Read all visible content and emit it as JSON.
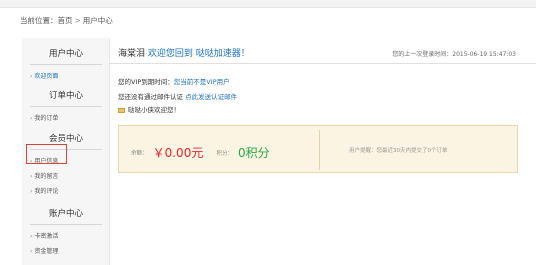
{
  "breadcrumb": {
    "prefix": "当前位置：",
    "home": "首页",
    "sep": ">",
    "current": "用户中心"
  },
  "sidebar": {
    "sections": [
      {
        "title": "用户中心",
        "items": [
          {
            "label": "欢迎页面",
            "active": true
          }
        ]
      },
      {
        "title": "订单中心",
        "items": [
          {
            "label": "我的订单"
          }
        ]
      },
      {
        "title": "会员中心",
        "items": [
          {
            "label": "用户信息"
          },
          {
            "label": "我的留言"
          },
          {
            "label": "我的评论"
          }
        ]
      },
      {
        "title": "账户中心",
        "items": [
          {
            "label": "卡密激活"
          },
          {
            "label": "资金管理"
          }
        ]
      }
    ]
  },
  "main": {
    "username": "海棠泪",
    "welcome": "欢迎您回到 哒哒加速器！",
    "last_login": "您的上一次登录时间：2015-06-19 15:47:03",
    "vip_label": "您的VIP到期时间：",
    "vip_value": "您当前不是VIP用户",
    "email_label": "您还没有通过邮件认证",
    "email_link": "点此发送认证邮件",
    "greeting": "哒哒小侠欢迎您！",
    "balance_label": "余额：",
    "balance_value": "￥0.00元",
    "points_label": "积分：",
    "points_value": "0积分",
    "tip": "用户提醒：您最近30天内提交了0个订单"
  },
  "colors": {
    "link_blue": "#1a6fc0",
    "money_red": "#e3262c",
    "points_green": "#28a745",
    "highlight": "#d9433a"
  }
}
